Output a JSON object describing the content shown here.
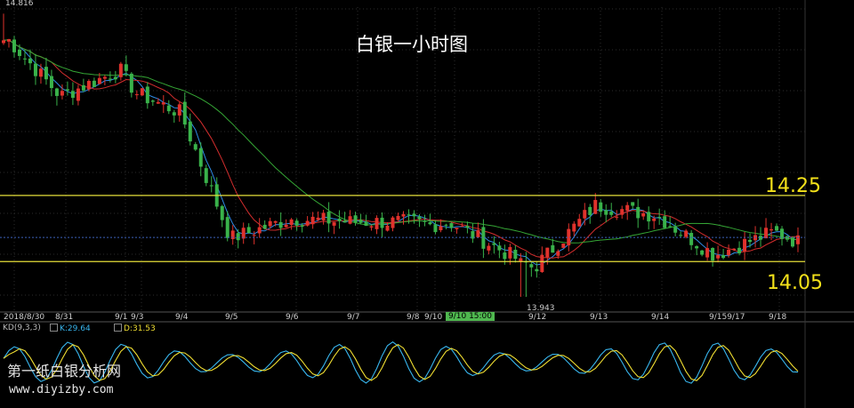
{
  "title": "白银一小时图",
  "watermark": {
    "line1": "第一纸白银分析网",
    "line2": "www.diyizby.com"
  },
  "colors": {
    "up": "#e0322c",
    "down": "#39b24a",
    "ma_fast": "#2f8be6",
    "ma_mid": "#d22d2d",
    "ma_slow": "#35a635",
    "level": "#e6df3a",
    "k": "#38b6ee",
    "d": "#f0de32",
    "background": "#000000"
  },
  "chart_data": [
    {
      "type": "candlestick",
      "title": "白银一小时图",
      "ylim": [
        13.9,
        14.82
      ],
      "x_ticks": [
        "2018/8/30",
        "8/31",
        "9/1",
        "9/3",
        "9/4",
        "9/5",
        "9/6",
        "9/7",
        "9/8",
        "9/10",
        "9/10 15:00",
        "9/12",
        "9/13",
        "9/14",
        "9/159/17",
        "9/18"
      ],
      "annotations": {
        "high": "14.816",
        "low": "13.943",
        "resistance": "14.25",
        "support": "14.05",
        "highlighted_time": "9/10 15:00"
      },
      "levels": [
        14.25,
        14.05
      ],
      "close_path": [
        {
          "x": "2018/8/30",
          "y": 14.72
        },
        {
          "x": "8/31",
          "y": 14.55
        },
        {
          "x": "9/1",
          "y": 14.63
        },
        {
          "x": "9/3",
          "y": 14.56
        },
        {
          "x": "9/4",
          "y": 14.5
        },
        {
          "x": "9/5",
          "y": 14.12
        },
        {
          "x": "9/6",
          "y": 14.18
        },
        {
          "x": "9/7",
          "y": 14.17
        },
        {
          "x": "9/8",
          "y": 14.17
        },
        {
          "x": "9/10",
          "y": 14.16
        },
        {
          "x": "9/10 15:00",
          "y": 14.17
        },
        {
          "x": "9/12",
          "y": 14.03
        },
        {
          "x": "9/13",
          "y": 14.22
        },
        {
          "x": "9/14",
          "y": 14.19
        },
        {
          "x": "9/159/17",
          "y": 14.07
        },
        {
          "x": "9/18",
          "y": 14.14
        }
      ]
    },
    {
      "type": "line",
      "title": "KD(9,3,3)",
      "series": [
        {
          "name": "K",
          "last": 29.64
        },
        {
          "name": "D",
          "last": 31.53
        }
      ]
    }
  ],
  "kd": {
    "label": "KD(9,3,3)",
    "k_text": "K:29.64",
    "d_text": "D:31.53"
  }
}
